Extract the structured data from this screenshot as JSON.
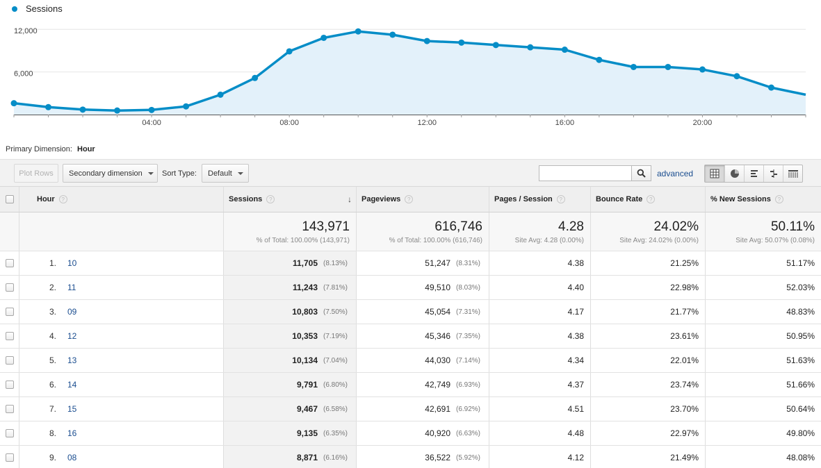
{
  "chart_data": {
    "type": "area",
    "legend": "Sessions",
    "color": "#058dc7",
    "fill": "#e3f1fa",
    "y_ticks": [
      "12,000",
      "6,000"
    ],
    "y_tick_values": [
      12000,
      6000
    ],
    "ylim": [
      0,
      13000
    ],
    "x_ticks": [
      "04:00",
      "08:00",
      "12:00",
      "16:00",
      "20:00"
    ],
    "x_tick_hours": [
      4,
      8,
      12,
      16,
      20
    ],
    "series": [
      {
        "values": [
          1600,
          1050,
          700,
          570,
          650,
          1150,
          2800,
          5150,
          8900,
          10803,
          11705,
          11243,
          10353,
          10134,
          9791,
          9467,
          9135,
          7700,
          6700,
          6700,
          6350,
          5400,
          3800,
          2800
        ]
      }
    ]
  },
  "primary_dimension": {
    "label": "Primary Dimension:",
    "value": "Hour"
  },
  "toolbar": {
    "plot_rows": "Plot Rows",
    "secondary_dimension": "Secondary dimension",
    "sort_type_label": "Sort Type:",
    "sort_type_value": "Default",
    "search_placeholder": "",
    "advanced": "advanced",
    "views": [
      "table-view-icon",
      "pie-view-icon",
      "performance-view-icon",
      "comparison-view-icon",
      "pivot-view-icon"
    ]
  },
  "table": {
    "headers": {
      "hour": "Hour",
      "sessions": "Sessions",
      "pageviews": "Pageviews",
      "pages_per_session": "Pages / Session",
      "bounce_rate": "Bounce Rate",
      "new_sessions": "% New Sessions"
    },
    "help_mark": "?",
    "sort_arrow": "↓",
    "totals": {
      "sessions": {
        "value": "143,971",
        "sub": "% of Total: 100.00% (143,971)"
      },
      "pageviews": {
        "value": "616,746",
        "sub": "% of Total: 100.00% (616,746)"
      },
      "pages_per_session": {
        "value": "4.28",
        "sub": "Site Avg: 4.28 (0.00%)"
      },
      "bounce_rate": {
        "value": "24.02%",
        "sub": "Site Avg: 24.02% (0.00%)"
      },
      "new_sessions": {
        "value": "50.11%",
        "sub": "Site Avg: 50.07% (0.08%)"
      }
    },
    "rows": [
      {
        "rank": "1.",
        "hour": "10",
        "sessions": "11,705",
        "sessions_pct": "(8.13%)",
        "pageviews": "51,247",
        "pageviews_pct": "(8.31%)",
        "pps": "4.38",
        "bounce": "21.25%",
        "new": "51.17%"
      },
      {
        "rank": "2.",
        "hour": "11",
        "sessions": "11,243",
        "sessions_pct": "(7.81%)",
        "pageviews": "49,510",
        "pageviews_pct": "(8.03%)",
        "pps": "4.40",
        "bounce": "22.98%",
        "new": "52.03%"
      },
      {
        "rank": "3.",
        "hour": "09",
        "sessions": "10,803",
        "sessions_pct": "(7.50%)",
        "pageviews": "45,054",
        "pageviews_pct": "(7.31%)",
        "pps": "4.17",
        "bounce": "21.77%",
        "new": "48.83%"
      },
      {
        "rank": "4.",
        "hour": "12",
        "sessions": "10,353",
        "sessions_pct": "(7.19%)",
        "pageviews": "45,346",
        "pageviews_pct": "(7.35%)",
        "pps": "4.38",
        "bounce": "23.61%",
        "new": "50.95%"
      },
      {
        "rank": "5.",
        "hour": "13",
        "sessions": "10,134",
        "sessions_pct": "(7.04%)",
        "pageviews": "44,030",
        "pageviews_pct": "(7.14%)",
        "pps": "4.34",
        "bounce": "22.01%",
        "new": "51.63%"
      },
      {
        "rank": "6.",
        "hour": "14",
        "sessions": "9,791",
        "sessions_pct": "(6.80%)",
        "pageviews": "42,749",
        "pageviews_pct": "(6.93%)",
        "pps": "4.37",
        "bounce": "23.74%",
        "new": "51.66%"
      },
      {
        "rank": "7.",
        "hour": "15",
        "sessions": "9,467",
        "sessions_pct": "(6.58%)",
        "pageviews": "42,691",
        "pageviews_pct": "(6.92%)",
        "pps": "4.51",
        "bounce": "23.70%",
        "new": "50.64%"
      },
      {
        "rank": "8.",
        "hour": "16",
        "sessions": "9,135",
        "sessions_pct": "(6.35%)",
        "pageviews": "40,920",
        "pageviews_pct": "(6.63%)",
        "pps": "4.48",
        "bounce": "22.97%",
        "new": "49.80%"
      },
      {
        "rank": "9.",
        "hour": "08",
        "sessions": "8,871",
        "sessions_pct": "(6.16%)",
        "pageviews": "36,522",
        "pageviews_pct": "(5.92%)",
        "pps": "4.12",
        "bounce": "21.49%",
        "new": "48.08%"
      }
    ]
  }
}
